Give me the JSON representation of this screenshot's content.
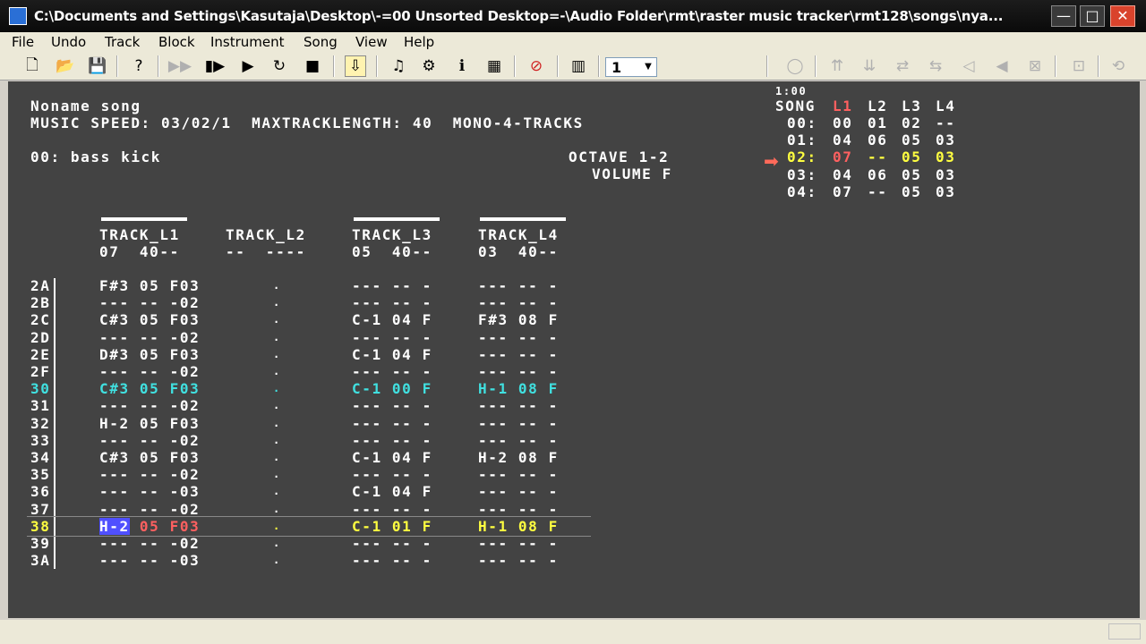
{
  "window": {
    "title": "C:\\Documents and Settings\\Kasutaja\\Desktop\\-=00 Unsorted Desktop=-\\Audio Folder\\rmt\\raster music tracker\\rmt128\\songs\\nya..."
  },
  "window_buttons": {
    "minimize": "—",
    "maximize": "□",
    "close": "✕"
  },
  "menu": [
    "File",
    "Undo",
    "Track",
    "Block",
    "Instrument",
    "Song",
    "View",
    "Help"
  ],
  "toolbar": {
    "octave_value": "1",
    "icons": {
      "new": "🗋",
      "open": "📂",
      "save": "💾",
      "help": "?",
      "play_dis": "▶▶",
      "play_pattern": "▮▶",
      "play": "▶",
      "loop": "↻",
      "stop": "■",
      "follow": "⇩",
      "note": "♫",
      "instrument": "⚙",
      "info": "ℹ",
      "tracks": "▦",
      "mute": "⊘",
      "piano": "▥",
      "d1": "◯",
      "d2": "⇈",
      "d3": "⇊",
      "d4": "⇄",
      "d5": "⇆",
      "d6": "◁",
      "d7": "◀",
      "d8": "⊠",
      "d9": "⊡",
      "d10": "⟲"
    }
  },
  "header": {
    "song_name": "Noname song",
    "speed_line": "MUSIC SPEED: 03/02/1  MAXTRACKLENGTH: 40  MONO-4-TRACKS",
    "instrument": "00: bass kick",
    "octave": "OCTAVE 1-2",
    "volume": "VOLUME F"
  },
  "song": {
    "time": "1:00",
    "label": "SONG",
    "cols": [
      "L1",
      "L2",
      "L3",
      "L4"
    ],
    "rows": [
      {
        "pos": "00:",
        "v": [
          "00",
          "01",
          "02",
          "--"
        ]
      },
      {
        "pos": "01:",
        "v": [
          "04",
          "06",
          "05",
          "03"
        ]
      },
      {
        "pos": "02:",
        "v": [
          "07",
          "--",
          "05",
          "03"
        ]
      },
      {
        "pos": "03:",
        "v": [
          "04",
          "06",
          "05",
          "03"
        ]
      },
      {
        "pos": "04:",
        "v": [
          "07",
          "--",
          "05",
          "03"
        ]
      }
    ]
  },
  "tracks": [
    {
      "name": "TRACK_L1",
      "info": "07  40--"
    },
    {
      "name": "TRACK_L2",
      "info": "--  ----"
    },
    {
      "name": "TRACK_L3",
      "info": "05  40--"
    },
    {
      "name": "TRACK_L4",
      "info": "03  40--"
    }
  ],
  "pattern": [
    {
      "n": "2A",
      "c": [
        "F#3 05 F03",
        ".",
        "--- -- -",
        "--- -- -"
      ]
    },
    {
      "n": "2B",
      "c": [
        "--- -- -02",
        ".",
        "--- -- -",
        "--- -- -"
      ]
    },
    {
      "n": "2C",
      "c": [
        "C#3 05 F03",
        ".",
        "C-1 04 F",
        "F#3 08 F"
      ]
    },
    {
      "n": "2D",
      "c": [
        "--- -- -02",
        ".",
        "--- -- -",
        "--- -- -"
      ]
    },
    {
      "n": "2E",
      "c": [
        "D#3 05 F03",
        ".",
        "C-1 04 F",
        "--- -- -"
      ]
    },
    {
      "n": "2F",
      "c": [
        "--- -- -02",
        ".",
        "--- -- -",
        "--- -- -"
      ]
    },
    {
      "n": "30",
      "c": [
        "C#3 05 F03",
        ".",
        "C-1 00 F",
        "H-1 08 F"
      ]
    },
    {
      "n": "31",
      "c": [
        "--- -- -02",
        ".",
        "--- -- -",
        "--- -- -"
      ]
    },
    {
      "n": "32",
      "c": [
        "H-2 05 F03",
        ".",
        "--- -- -",
        "--- -- -"
      ]
    },
    {
      "n": "33",
      "c": [
        "--- -- -02",
        ".",
        "--- -- -",
        "--- -- -"
      ]
    },
    {
      "n": "34",
      "c": [
        "C#3 05 F03",
        ".",
        "C-1 04 F",
        "H-2 08 F"
      ]
    },
    {
      "n": "35",
      "c": [
        "--- -- -02",
        ".",
        "--- -- -",
        "--- -- -"
      ]
    },
    {
      "n": "36",
      "c": [
        "--- -- -03",
        ".",
        "C-1 04 F",
        "--- -- -"
      ]
    },
    {
      "n": "37",
      "c": [
        "--- -- -02",
        ".",
        "--- -- -",
        "--- -- -"
      ]
    },
    {
      "n": "38",
      "c": [
        "H-2 05 F03",
        ".",
        "C-1 01 F",
        "H-1 08 F"
      ]
    },
    {
      "n": "39",
      "c": [
        "--- -- -02",
        ".",
        "--- -- -",
        "--- -- -"
      ]
    },
    {
      "n": "3A",
      "c": [
        "--- -- -03",
        ".",
        "--- -- -",
        "--- -- -"
      ]
    }
  ],
  "colors": {
    "bg": "#434343",
    "text": "#ffffff",
    "highlight": "#ffff40",
    "beat": "#40e0e0",
    "accent": "#ff6060",
    "cursor": "#5050ff"
  }
}
